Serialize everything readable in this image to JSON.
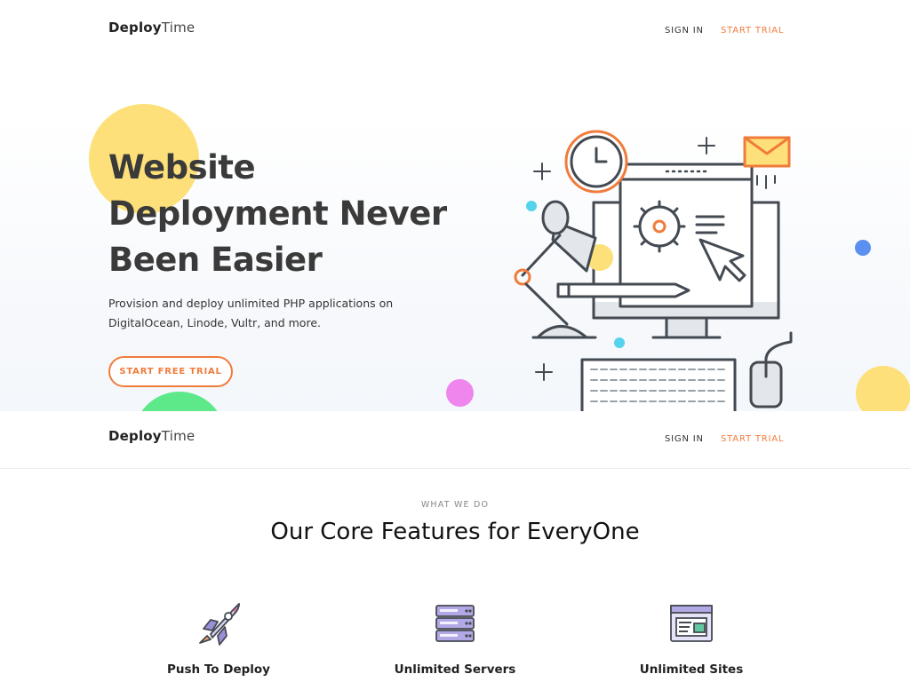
{
  "brand": {
    "name_bold": "Deploy",
    "name_light": "Time"
  },
  "nav": {
    "sign_in": "SIGN IN",
    "start_trial": "START TRIAL"
  },
  "hero": {
    "title_lines": [
      "Website",
      "Deployment Never",
      "Been Easier"
    ],
    "subtitle": "Provision and deploy unlimited PHP applications on DigitalOcean, Linode, Vultr, and more.",
    "cta": "START FREE TRIAL"
  },
  "features_section": {
    "eyebrow": "WHAT WE DO",
    "title": "Our Core Features for EveryOne",
    "items": [
      {
        "label": "Push To Deploy",
        "icon": "rocket-icon"
      },
      {
        "label": "Unlimited Servers",
        "icon": "server-icon"
      },
      {
        "label": "Unlimited Sites",
        "icon": "browser-window-icon"
      }
    ]
  },
  "colors": {
    "accent": "#f07c3c",
    "yellow": "#fde07a",
    "green": "#5de88a",
    "pink": "#ee86ee",
    "blue": "#5b8ff0",
    "cyan": "#55d3ec",
    "outline": "#444a52"
  }
}
